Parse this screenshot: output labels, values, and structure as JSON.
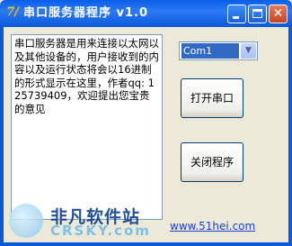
{
  "window": {
    "app_icon": "7/",
    "title": "串口服务器程序 v1.0",
    "close_glyph": "✕"
  },
  "memo": {
    "text": "串口服务器是用来连接以太网以及其他设备的，用户接收到的内容以及运行状态将会以16进制的形式显示在这里，作者qq: 125739409，欢迎提出您宝贵的意见"
  },
  "port_select": {
    "value": "Com1",
    "arrow": "▼"
  },
  "buttons": {
    "open_port": "打开串口",
    "close_program": "关闭程序"
  },
  "link": {
    "text": "www.51hei.com"
  },
  "watermark": {
    "brand": "非凡软件站",
    "domain": "CRSKY.com"
  }
}
